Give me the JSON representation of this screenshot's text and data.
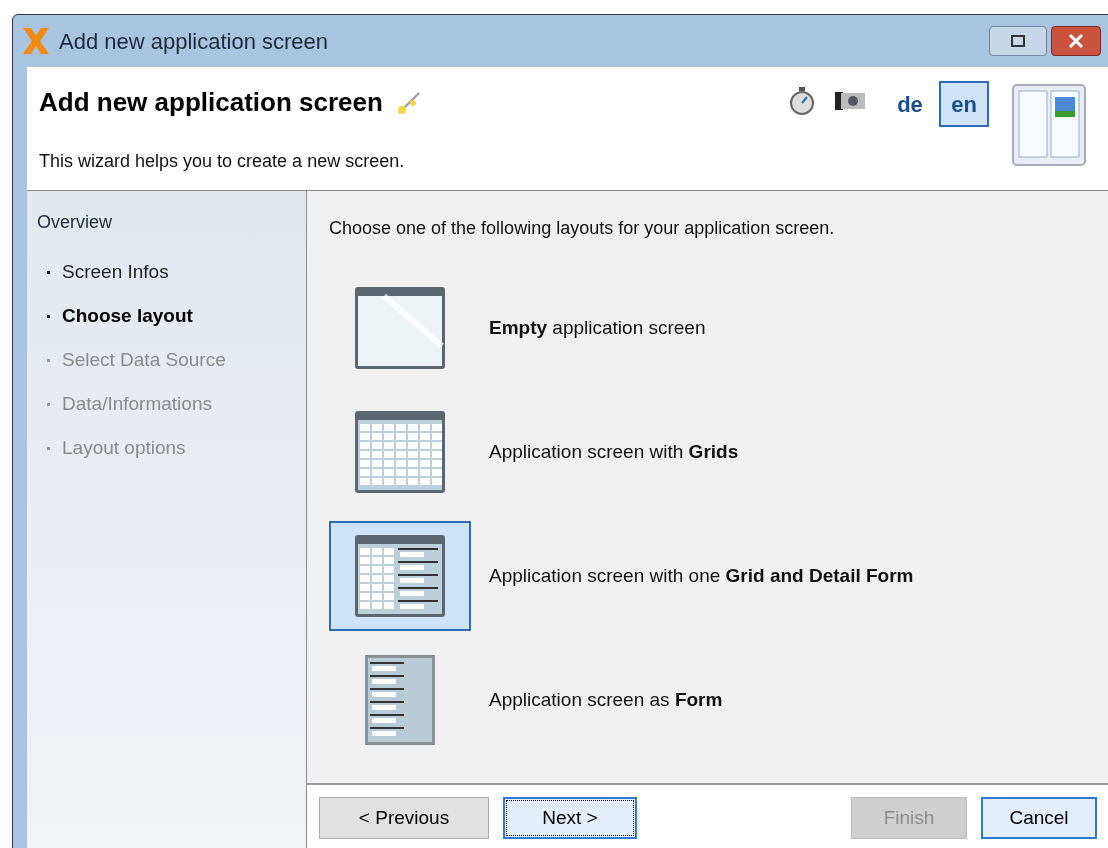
{
  "window": {
    "title": "Add new application screen"
  },
  "header": {
    "title": "Add new application screen",
    "subtitle": "This wizard helps you to create a new screen.",
    "languages": [
      {
        "label": "de",
        "selected": false
      },
      {
        "label": "en",
        "selected": true
      }
    ]
  },
  "sidebar": {
    "title": "Overview",
    "items": [
      {
        "label": "Screen Infos",
        "selected": false,
        "disabled": false
      },
      {
        "label": "Choose layout",
        "selected": true,
        "disabled": false
      },
      {
        "label": "Select Data Source",
        "selected": false,
        "disabled": true
      },
      {
        "label": "Data/Informations",
        "selected": false,
        "disabled": true
      },
      {
        "label": "Layout options",
        "selected": false,
        "disabled": true
      }
    ]
  },
  "content": {
    "prompt": "Choose one of the following layouts for your application screen.",
    "layouts": [
      {
        "kind": "empty",
        "label": "**Empty** application screen",
        "selected": false
      },
      {
        "kind": "grid",
        "label": "Application screen with **Grids**",
        "selected": false
      },
      {
        "kind": "grid-form",
        "label": "Application screen with one **Grid and Detail Form**",
        "selected": true
      },
      {
        "kind": "form",
        "label": "Application screen as **Form**",
        "selected": false
      }
    ]
  },
  "buttons": [
    {
      "label": "< Previous",
      "disabled": false,
      "focused": false
    },
    {
      "label": "Next >",
      "disabled": false,
      "focused": true
    },
    {
      "label": "Finish",
      "disabled": true,
      "focused": false
    },
    {
      "label": "Cancel",
      "disabled": false,
      "focused": false
    }
  ]
}
